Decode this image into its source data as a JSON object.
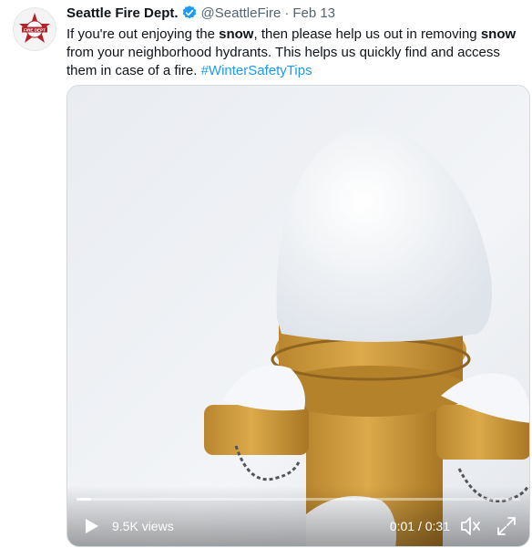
{
  "tweet": {
    "author_name": "Seattle Fire Dept.",
    "handle": "@SeattleFire",
    "separator": "·",
    "date": "Feb 13",
    "verified_icon": "verified-badge-icon",
    "text": {
      "part1": "If you're out enjoying the ",
      "bold1": "snow",
      "part2": ", then please help us out in removing ",
      "bold2": "snow",
      "part3": " from your neighborhood hydrants. This helps us quickly find and access them in case of a fire. ",
      "hashtag": "#WinterSafetyTips"
    },
    "avatar_text": "FIRE DEPT"
  },
  "video": {
    "views": "9.5K views",
    "time": "0:01 / 0:31",
    "progress_fraction": 0.032,
    "icons": [
      "play-icon",
      "volume-mute-icon",
      "fullscreen-icon"
    ]
  },
  "colors": {
    "accent": "#1d9bf0",
    "verified": "#1d9bf0",
    "secondary_text": "#536471",
    "hydrant": "#d9a441"
  }
}
